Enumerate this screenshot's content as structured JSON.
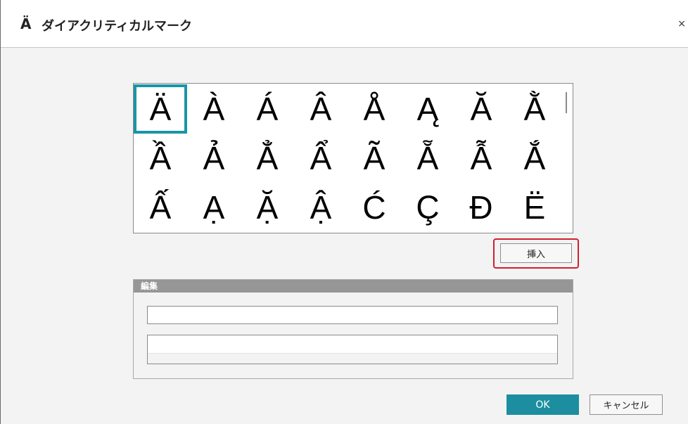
{
  "titlebar": {
    "glyph": "Ä",
    "title": "ダイアクリティカルマーク",
    "close": "×"
  },
  "grid": {
    "selected_index": 0,
    "characters": [
      "Ä",
      "À",
      "Á",
      "Â",
      "Å",
      "Ą",
      "Ă",
      "Ằ",
      "Ầ",
      "Ả",
      "Ẳ",
      "Ẩ",
      "Ã",
      "Ẵ",
      "Ẫ",
      "Ắ",
      "Ấ",
      "Ạ",
      "Ặ",
      "Ậ",
      "Ć",
      "Ç",
      "Đ",
      "Ë"
    ]
  },
  "insert_button": {
    "label": "挿入"
  },
  "edit": {
    "header": "編集",
    "field1_value": "",
    "field2_value": ""
  },
  "footer": {
    "ok_label": "OK",
    "cancel_label": "キャンセル"
  },
  "colors": {
    "accent": "#1a95a5",
    "ok_button": "#1c8ea0",
    "highlight": "#cf1f2f",
    "group_header": "#969696"
  }
}
